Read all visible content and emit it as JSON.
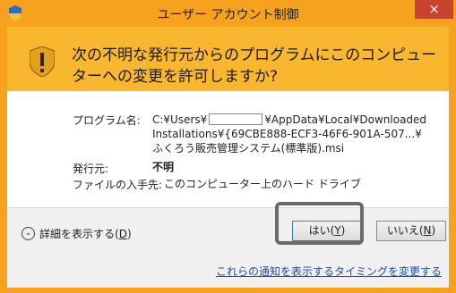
{
  "window": {
    "title": "ユーザー アカウント制御",
    "close_label": "×"
  },
  "banner": {
    "message": "次の不明な発行元からのプログラムにこのコンピューターへの変更を許可しますか?"
  },
  "details": {
    "program_label": "プログラム名:",
    "program_line1_a": "C:¥Users¥",
    "program_line1_b": "¥AppData¥Local¥Downloaded",
    "program_line2": "Installations¥{69CBE888-ECF3-46F6-901A-507...¥",
    "program_line3": "ふくろう販売管理システム(標準版).msi",
    "publisher_label": "発行元:",
    "publisher_value": "不明",
    "origin_label": "ファイルの入手先:",
    "origin_value": "このコンピューター上のハード ドライブ"
  },
  "footer": {
    "show_details_prefix": "詳細を表示する(",
    "show_details_key": "D",
    "show_details_suffix": ")",
    "yes_prefix": "はい(",
    "yes_key": "Y",
    "yes_suffix": ")",
    "no_prefix": "いいえ(",
    "no_key": "N",
    "no_suffix": ")",
    "notification_link": "これらの通知を表示するタイミングを変更する"
  },
  "icons": {
    "title_icon": "uac-shield-icon",
    "banner_icon": "uac-shield-large-icon",
    "expand_icon": "chevron-down-circle-icon"
  },
  "colors": {
    "title_bar": "#f6a21f",
    "banner": "#f9b62f",
    "close_button": "#c7422f",
    "link": "#1a4fb0"
  }
}
